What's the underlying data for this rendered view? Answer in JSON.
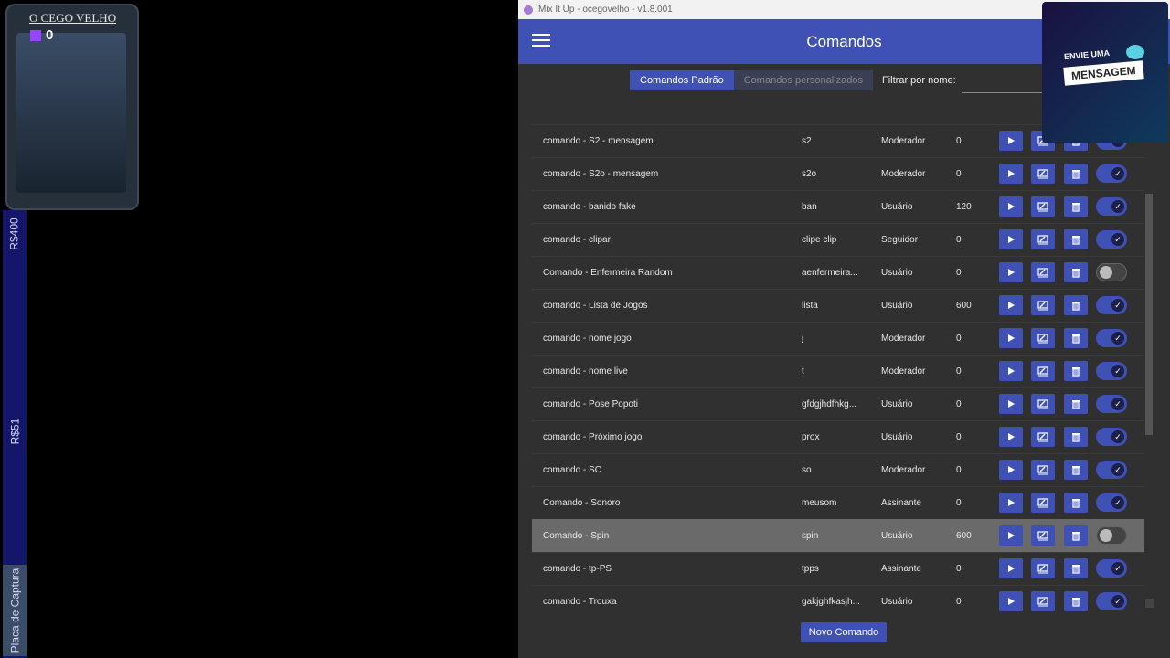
{
  "overlay": {
    "streamer_name": "O CEGO VELHO",
    "follower_count": "0",
    "goals": [
      "R$400",
      "R$51"
    ],
    "capture_label": "Placa de Captura",
    "message_card_top": "ENVIE UMA",
    "message_card_main": "MENSAGEM"
  },
  "window": {
    "title": "Mix It Up - ocegovelho - v1.8.001"
  },
  "appbar": {
    "title": "Comandos"
  },
  "tabs": [
    {
      "label": "Comandos Padrão",
      "active": true
    },
    {
      "label": "Comandos personalizados",
      "active": false
    }
  ],
  "filter": {
    "label": "Filtrar por nome:",
    "value": ""
  },
  "commands": [
    {
      "name": "comando - S2 - mensagem",
      "trigger": "s2",
      "role": "Moderador",
      "cooldown": "0",
      "enabled": true,
      "highlighted": false
    },
    {
      "name": "comando - S2o - mensagem",
      "trigger": "s2o",
      "role": "Moderador",
      "cooldown": "0",
      "enabled": true,
      "highlighted": false
    },
    {
      "name": "comando - banido fake",
      "trigger": "ban",
      "role": "Usuário",
      "cooldown": "120",
      "enabled": true,
      "highlighted": false
    },
    {
      "name": "comando - clipar",
      "trigger": "clipe clip",
      "role": "Seguidor",
      "cooldown": "0",
      "enabled": true,
      "highlighted": false
    },
    {
      "name": "Comando - Enfermeira Random",
      "trigger": "aenfermeira...",
      "role": "Usuário",
      "cooldown": "0",
      "enabled": false,
      "highlighted": false
    },
    {
      "name": "comando - Lista de Jogos",
      "trigger": "lista",
      "role": "Usuário",
      "cooldown": "600",
      "enabled": true,
      "highlighted": false
    },
    {
      "name": "comando - nome jogo",
      "trigger": "j",
      "role": "Moderador",
      "cooldown": "0",
      "enabled": true,
      "highlighted": false
    },
    {
      "name": "comando - nome live",
      "trigger": "t",
      "role": "Moderador",
      "cooldown": "0",
      "enabled": true,
      "highlighted": false
    },
    {
      "name": "comando - Pose Popoti",
      "trigger": "gfdgjhdfhkg...",
      "role": "Usuário",
      "cooldown": "0",
      "enabled": true,
      "highlighted": false
    },
    {
      "name": "comando - Próximo jogo",
      "trigger": "prox",
      "role": "Usuário",
      "cooldown": "0",
      "enabled": true,
      "highlighted": false
    },
    {
      "name": "comando - SO",
      "trigger": "so",
      "role": "Moderador",
      "cooldown": "0",
      "enabled": true,
      "highlighted": false
    },
    {
      "name": "Comando - Sonoro",
      "trigger": "meusom",
      "role": "Assinante",
      "cooldown": "0",
      "enabled": true,
      "highlighted": false
    },
    {
      "name": "Comando - Spin",
      "trigger": "spin",
      "role": "Usuário",
      "cooldown": "600",
      "enabled": false,
      "highlighted": true
    },
    {
      "name": "comando - tp-PS",
      "trigger": "tpps",
      "role": "Assinante",
      "cooldown": "0",
      "enabled": true,
      "highlighted": false
    },
    {
      "name": "comando - Trouxa",
      "trigger": "gakjghfkasjh...",
      "role": "Usuário",
      "cooldown": "0",
      "enabled": true,
      "highlighted": false
    }
  ],
  "new_command_label": "Novo Comando",
  "colors": {
    "accent": "#3f51b5",
    "background": "#303030"
  }
}
